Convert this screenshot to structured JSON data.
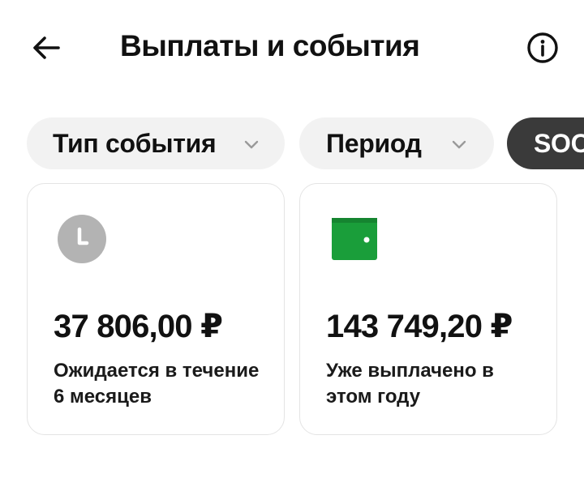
{
  "header": {
    "title": "Выплаты и события",
    "back_icon": "arrow-left-icon",
    "info_icon": "info-circle-icon"
  },
  "filters": {
    "event_type_label": "Тип события",
    "period_label": "Период",
    "third_chip_label": "SOOI"
  },
  "cards": [
    {
      "icon": "clock-icon",
      "icon_color": "#b3b3b3",
      "amount": "37 806,00 ₽",
      "description": "Ожидается в течение 6 месяцев"
    },
    {
      "icon": "wallet-icon",
      "icon_color": "#1a9e3a",
      "amount": "143 749,20 ₽",
      "description": "Уже выплачено в этом году"
    }
  ],
  "colors": {
    "chip_background": "#f2f2f2",
    "dark_chip_background": "#3a3a3a",
    "card_border": "#e4e4e4"
  }
}
